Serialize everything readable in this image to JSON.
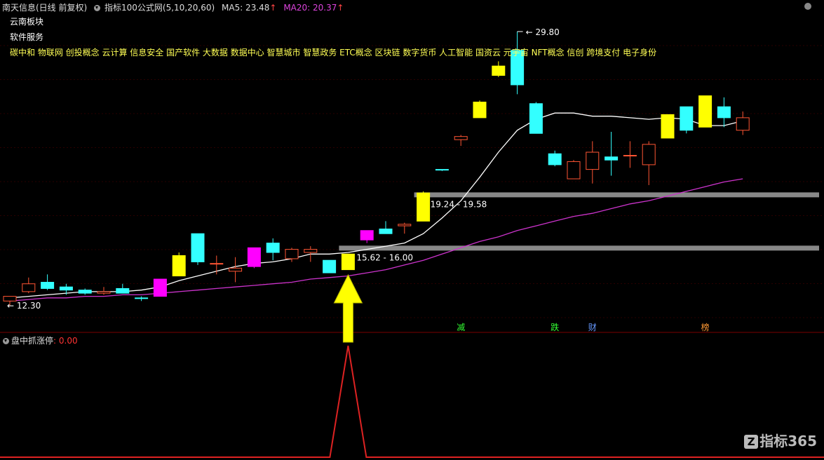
{
  "header": {
    "stock": "南天信息(日线 前复权)",
    "indicator": "指标100公式网(5,10,20,60)",
    "ma5_label": "MA5: 23.48",
    "ma5_arrow": "↑",
    "ma20_label": "MA20: 20.37",
    "ma20_arrow": "↑"
  },
  "sectors": [
    "云南板块",
    "软件服务"
  ],
  "concepts": "碳中和 物联网 创投概念 云计算 信息安全 国产软件 大数据 数据中心 智慧城市 智慧政务 ETC概念 区块链 数字货币 人工智能 国资云 元宇宙 NFT概念 信创 跨境支付 电子身份",
  "subchart": {
    "title": "盘中抓涨停",
    "value": ": 0.00"
  },
  "watermark": "指标365",
  "colors": {
    "up": "#ff5533",
    "down": "#33ffff",
    "yellow": "#ffff00",
    "magenta": "#ff00ff",
    "ma5": "#ffffff",
    "ma20": "#cc33cc",
    "zone": "#888888",
    "signal": "#dd2222"
  },
  "chart_data": {
    "type": "candlestick",
    "y_axis": {
      "price_at_top_ref": 29.8,
      "price_at_bottom_ref": 12.3
    },
    "candles": [
      {
        "o": 12.6,
        "h": 12.8,
        "l": 12.3,
        "c": 12.9,
        "color": "up"
      },
      {
        "o": 13.2,
        "h": 14.1,
        "l": 13.1,
        "c": 13.7,
        "color": "up"
      },
      {
        "o": 13.8,
        "h": 14.3,
        "l": 13.3,
        "c": 13.4,
        "color": "down"
      },
      {
        "o": 13.5,
        "h": 13.7,
        "l": 13.0,
        "c": 13.3,
        "color": "down"
      },
      {
        "o": 13.3,
        "h": 13.4,
        "l": 13.0,
        "c": 13.1,
        "color": "down"
      },
      {
        "o": 13.1,
        "h": 13.5,
        "l": 13.0,
        "c": 13.2,
        "color": "up"
      },
      {
        "o": 13.4,
        "h": 13.7,
        "l": 13.1,
        "c": 13.1,
        "color": "down"
      },
      {
        "o": 12.8,
        "h": 12.9,
        "l": 12.6,
        "c": 12.8,
        "color": "down"
      },
      {
        "o": 12.9,
        "h": 14.0,
        "l": 12.9,
        "c": 14.0,
        "color": "magenta"
      },
      {
        "o": 14.2,
        "h": 15.7,
        "l": 14.2,
        "c": 15.5,
        "color": "yellow"
      },
      {
        "o": 16.9,
        "h": 16.9,
        "l": 14.9,
        "c": 15.1,
        "color": "down"
      },
      {
        "o": 15.0,
        "h": 15.5,
        "l": 14.3,
        "c": 15.0,
        "color": "up"
      },
      {
        "o": 14.5,
        "h": 15.4,
        "l": 13.8,
        "c": 14.7,
        "color": "up"
      },
      {
        "o": 14.8,
        "h": 16.0,
        "l": 14.7,
        "c": 16.0,
        "color": "magenta"
      },
      {
        "o": 16.3,
        "h": 16.6,
        "l": 15.2,
        "c": 15.7,
        "color": "down"
      },
      {
        "o": 15.3,
        "h": 16.0,
        "l": 15.1,
        "c": 15.9,
        "color": "up"
      },
      {
        "o": 15.7,
        "h": 16.1,
        "l": 15.1,
        "c": 15.9,
        "color": "up"
      },
      {
        "o": 15.2,
        "h": 15.2,
        "l": 14.4,
        "c": 14.4,
        "color": "down"
      },
      {
        "o": 14.6,
        "h": 15.6,
        "l": 14.6,
        "c": 15.6,
        "color": "yellow"
      },
      {
        "o": 16.5,
        "h": 17.1,
        "l": 16.3,
        "c": 17.1,
        "color": "magenta"
      },
      {
        "o": 17.2,
        "h": 17.7,
        "l": 16.9,
        "c": 16.9,
        "color": "down"
      },
      {
        "o": 17.4,
        "h": 17.6,
        "l": 16.9,
        "c": 17.5,
        "color": "up"
      },
      {
        "o": 17.7,
        "h": 19.6,
        "l": 17.7,
        "c": 19.5,
        "color": "yellow"
      },
      {
        "o": 21.0,
        "h": 21.0,
        "l": 20.9,
        "c": 21.0,
        "color": "down"
      },
      {
        "o": 23.1,
        "h": 23.2,
        "l": 22.5,
        "c": 22.9,
        "color": "up"
      },
      {
        "o": 24.3,
        "h": 25.4,
        "l": 24.3,
        "c": 25.3,
        "color": "yellow"
      },
      {
        "o": 27.0,
        "h": 27.9,
        "l": 26.9,
        "c": 27.6,
        "color": "yellow"
      },
      {
        "o": 28.6,
        "h": 29.8,
        "l": 25.8,
        "c": 26.4,
        "color": "down"
      },
      {
        "o": 25.2,
        "h": 25.3,
        "l": 23.3,
        "c": 23.3,
        "color": "down"
      },
      {
        "o": 22.0,
        "h": 22.2,
        "l": 21.2,
        "c": 21.3,
        "color": "down"
      },
      {
        "o": 20.4,
        "h": 21.6,
        "l": 20.4,
        "c": 21.5,
        "color": "up"
      },
      {
        "o": 21.0,
        "h": 22.8,
        "l": 20.1,
        "c": 22.1,
        "color": "up"
      },
      {
        "o": 21.8,
        "h": 23.4,
        "l": 20.6,
        "c": 21.6,
        "color": "down"
      },
      {
        "o": 21.9,
        "h": 22.8,
        "l": 21.1,
        "c": 21.9,
        "color": "up"
      },
      {
        "o": 21.3,
        "h": 22.8,
        "l": 20.0,
        "c": 22.6,
        "color": "up"
      },
      {
        "o": 23.0,
        "h": 24.5,
        "l": 23.0,
        "c": 24.5,
        "color": "yellow"
      },
      {
        "o": 25.0,
        "h": 25.0,
        "l": 23.3,
        "c": 23.5,
        "color": "down"
      },
      {
        "o": 23.7,
        "h": 25.7,
        "l": 23.7,
        "c": 25.7,
        "color": "yellow"
      },
      {
        "o": 25.0,
        "h": 25.6,
        "l": 23.7,
        "c": 24.3,
        "color": "down"
      },
      {
        "o": 23.5,
        "h": 24.7,
        "l": 23.2,
        "c": 24.3,
        "color": "up"
      }
    ],
    "ma5": [
      12.8,
      12.9,
      13.0,
      13.1,
      13.2,
      13.2,
      13.2,
      13.3,
      13.5,
      13.9,
      14.2,
      14.5,
      14.8,
      15.0,
      15.1,
      15.3,
      15.6,
      15.6,
      15.7,
      15.9,
      16.1,
      16.3,
      16.9,
      17.9,
      19.0,
      20.5,
      22.1,
      23.5,
      24.2,
      24.6,
      24.6,
      24.4,
      24.4,
      24.3,
      24.2,
      24.3,
      24.2,
      23.8,
      23.8,
      24.1
    ],
    "ma20": [
      12.6,
      12.7,
      12.8,
      12.8,
      12.9,
      12.9,
      13.0,
      13.0,
      13.1,
      13.2,
      13.3,
      13.4,
      13.5,
      13.6,
      13.7,
      13.8,
      14.0,
      14.1,
      14.2,
      14.4,
      14.6,
      14.9,
      15.2,
      15.6,
      16.0,
      16.4,
      16.7,
      17.1,
      17.4,
      17.7,
      18.0,
      18.2,
      18.5,
      18.8,
      19.0,
      19.3,
      19.6,
      19.9,
      20.2,
      20.4
    ],
    "annotations": {
      "high_label": "29.80",
      "low_label": "12.30",
      "zone1_label": "19.24 - 19.58",
      "zone2_label": "15.62 - 16.00"
    },
    "zones": [
      {
        "from_index": 22,
        "price": 19.4
      },
      {
        "from_index": 18,
        "price": 16.0
      }
    ],
    "event_markers": [
      {
        "index": 24,
        "text": "减",
        "color": "#33ff33"
      },
      {
        "index": 29,
        "text": "跌",
        "color": "#33ff33"
      },
      {
        "index": 31,
        "text": "财",
        "color": "#6699ff"
      },
      {
        "index": 37,
        "text": "榜",
        "color": "#ff9933"
      }
    ],
    "signal": {
      "index": 18,
      "series_baseline": 0,
      "peak": 1
    }
  }
}
